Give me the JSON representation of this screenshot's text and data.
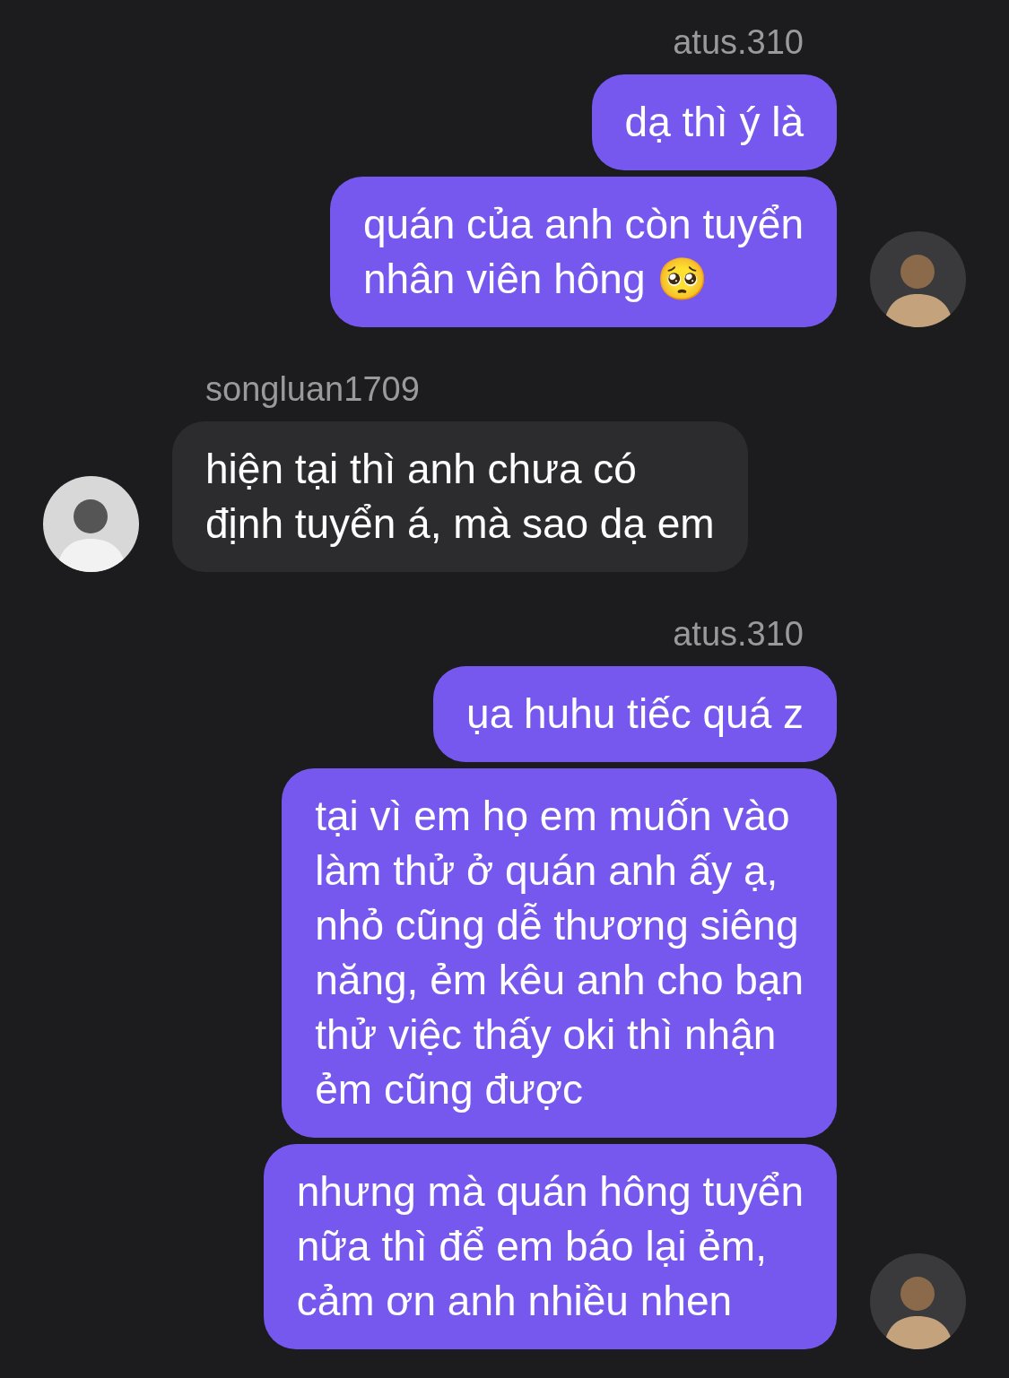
{
  "groups": [
    {
      "kind": "outgoing",
      "sender": "atus.310",
      "messages": [
        {
          "text": "dạ thì ý là"
        },
        {
          "text": "quán của anh còn tuyển\nnhân viên hông 🥺"
        }
      ]
    },
    {
      "kind": "incoming",
      "sender": "songluan1709",
      "messages": [
        {
          "text": "hiện tại thì anh chưa có\nđịnh tuyển á, mà sao dạ em"
        }
      ]
    },
    {
      "kind": "outgoing",
      "sender": "atus.310",
      "messages": [
        {
          "text": "ụa huhu tiếc quá z"
        },
        {
          "text": "tại vì em họ em muốn vào\nlàm thử ở quán anh ấy ạ,\nnhỏ cũng dễ thương siêng\nnăng, ẻm kêu anh cho bạn\nthử việc thấy oki thì nhận\nẻm cũng được"
        },
        {
          "text": "nhưng mà quán hông tuyển\nnữa thì để em báo lại ẻm,\ncảm ơn anh nhiều nhen"
        }
      ]
    }
  ]
}
